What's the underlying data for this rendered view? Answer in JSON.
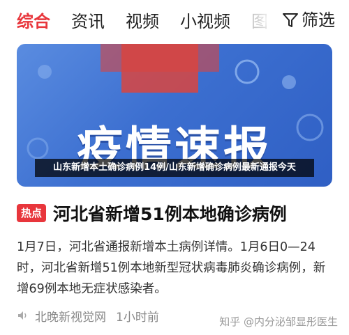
{
  "tabs": [
    {
      "label": "综合",
      "active": true
    },
    {
      "label": "资讯",
      "active": false
    },
    {
      "label": "视频",
      "active": false
    },
    {
      "label": "小视频",
      "active": false
    },
    {
      "label": "图",
      "active": false
    }
  ],
  "filter": {
    "label": "筛选",
    "icon": "filter-icon"
  },
  "banner": {
    "title": "疫情速报",
    "caption": "山东新增本土确诊病例14例/山东新增确诊病例最新通报今天"
  },
  "article": {
    "badge": "热点",
    "title": "河北省新增51例本地确诊病例",
    "body": "1月7日，河北省通报新增本土病例详情。1月6日0—24时，河北省新增51例本地新型冠状病毒肺炎确诊病例，新增69例本地无症状感染者。",
    "source": "北晚新视觉网",
    "time": "1小时前",
    "source_icon": "speaker-icon"
  },
  "watermark": "知乎 @内分泌邹显彤医生",
  "colors": {
    "accent": "#e8363c",
    "banner": "#3c6fd0"
  }
}
